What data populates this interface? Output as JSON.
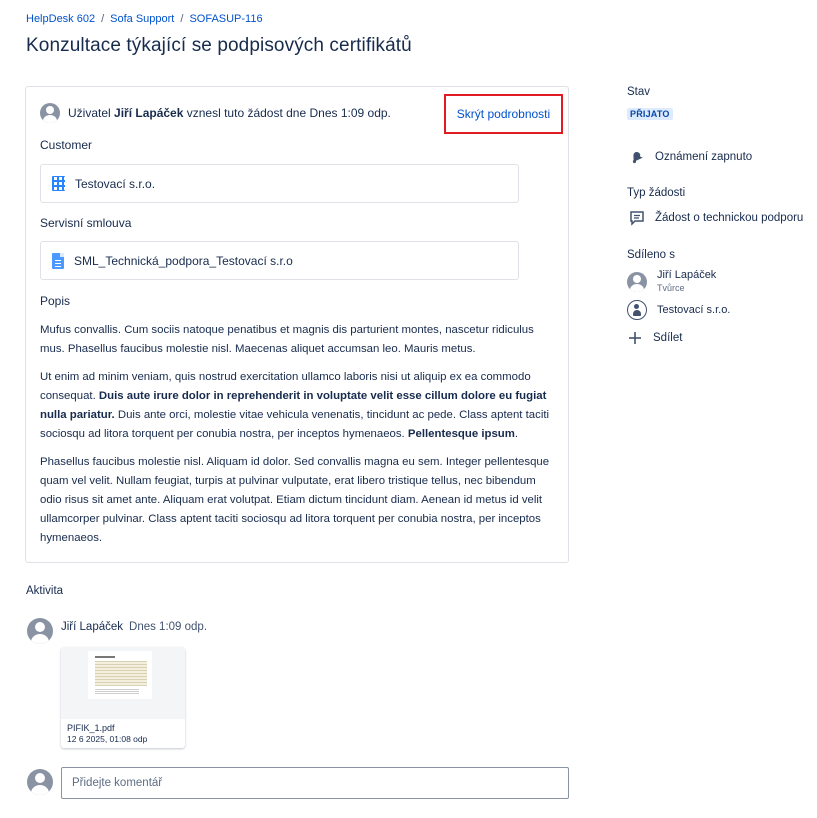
{
  "breadcrumb": {
    "items": [
      "HelpDesk 602",
      "Sofa Support",
      "SOFASUP-116"
    ],
    "separator": "/"
  },
  "page_title": "Konzultace týkající se podpisových certifikátů",
  "details": {
    "reporter_prefix": "Uživatel",
    "reporter_name": "Jiří Lapáček",
    "reporter_suffix": "vznesl tuto žádost dne Dnes 1:09 odp.",
    "hide_details_label": "Skrýt podrobnosti",
    "customer_label": "Customer",
    "customer_value": "Testovací s.r.o.",
    "contract_label": "Servisní smlouva",
    "contract_value": "SML_Technická_podpora_Testovací s.r.o",
    "description_label": "Popis",
    "description": {
      "p1": "Mufus convallis. Cum sociis natoque penatibus et magnis dis parturient montes, nascetur ridiculus mus. Phasellus faucibus molestie nisl. Maecenas aliquet accumsan leo. Mauris metus.",
      "p2_a": "Ut enim ad minim veniam, quis nostrud exercitation ullamco laboris nisi ut aliquip ex ea commodo consequat.",
      "p2_b": "Duis aute irure dolor in reprehenderit in voluptate velit esse cillum dolore eu fugiat nulla pariatur.",
      "p2_c": "Duis ante orci, molestie vitae vehicula venenatis, tincidunt ac pede. Class aptent taciti sociosqu ad litora torquent per conubia nostra, per inceptos hymenaeos.",
      "p2_d": "Pellentesque ipsum",
      "p2_e": ".",
      "p3": "Phasellus faucibus molestie nisl. Aliquam id dolor. Sed convallis magna eu sem. Integer pellentesque quam vel velit. Nullam feugiat, turpis at pulvinar vulputate, erat libero tristique tellus, nec bibendum odio risus sit amet ante. Aliquam erat volutpat. Etiam dictum tincidunt diam. Aenean id metus id velit ullamcorper pulvinar. Class aptent taciti sociosqu ad litora torquent per conubia nostra, per inceptos hymenaeos."
    }
  },
  "sidebar": {
    "status_label": "Stav",
    "status_value": "PŘIJATO",
    "notifications": "Oznámení zapnuto",
    "request_type_label": "Typ žádosti",
    "request_type_value": "Žádost o technickou podporu",
    "shared_label": "Sdíleno s",
    "shared_person_name": "Jiří Lapáček",
    "shared_person_role": "Tvůrce",
    "shared_org": "Testovací s.r.o.",
    "share_button": "Sdílet"
  },
  "activity": {
    "title": "Aktivita",
    "author": "Jiří Lapáček",
    "time": "Dnes 1:09 odp.",
    "attachment_name": "PIFIK_1.pdf",
    "attachment_date": "12 6 2025, 01:08 odp",
    "comment_placeholder": "Přidejte komentář"
  },
  "colors": {
    "link": "#0052cc",
    "highlight_border": "#e01b24",
    "status_bg": "#deebff",
    "status_text": "#0747a6"
  }
}
